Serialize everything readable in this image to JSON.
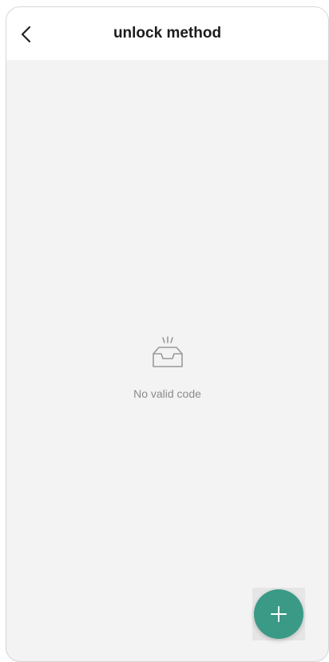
{
  "header": {
    "title": "unlock method",
    "back_icon": "chevron-left-icon"
  },
  "empty_state": {
    "icon": "empty-inbox-icon",
    "message": "No valid code"
  },
  "fab": {
    "icon": "plus-icon",
    "color": "#3a9a86"
  },
  "colors": {
    "background": "#f3f3f3",
    "header": "#ffffff",
    "text_muted": "#8b8b8b"
  }
}
